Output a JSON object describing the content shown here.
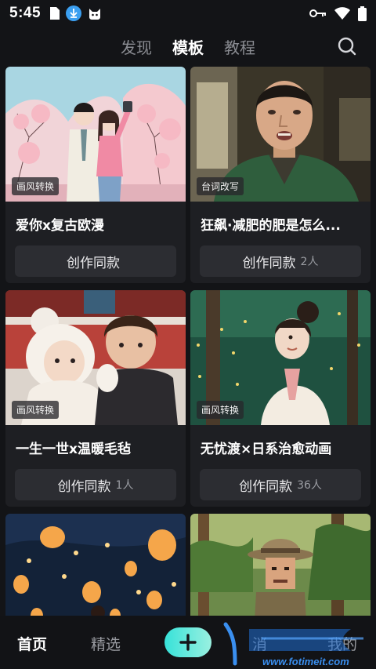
{
  "status_bar": {
    "time": "5:45"
  },
  "top_tabs": [
    {
      "label": "发现"
    },
    {
      "label": "模板"
    },
    {
      "label": "教程"
    }
  ],
  "cards": [
    {
      "tag": "画风转换",
      "title": "爱你x复古欧漫",
      "button_label": "创作同款",
      "count": ""
    },
    {
      "tag": "台词改写",
      "title": "狂飙·减肥的肥是怎么...",
      "button_label": "创作同款",
      "count": "2人"
    },
    {
      "tag": "画风转换",
      "title": "一生一世x温暖毛毡",
      "button_label": "创作同款",
      "count": "1人"
    },
    {
      "tag": "画风转换",
      "title": "无忧渡×日系治愈动画",
      "button_label": "创作同款",
      "count": "36人"
    }
  ],
  "bottom_nav": {
    "home": "首页",
    "featured": "精选",
    "messages": "消",
    "mine": "我的"
  },
  "watermark": {
    "text": "www.fotimeit.com"
  },
  "colors": {
    "accent": "#37e2d9",
    "background": "#131417",
    "card": "#1e1f23"
  }
}
